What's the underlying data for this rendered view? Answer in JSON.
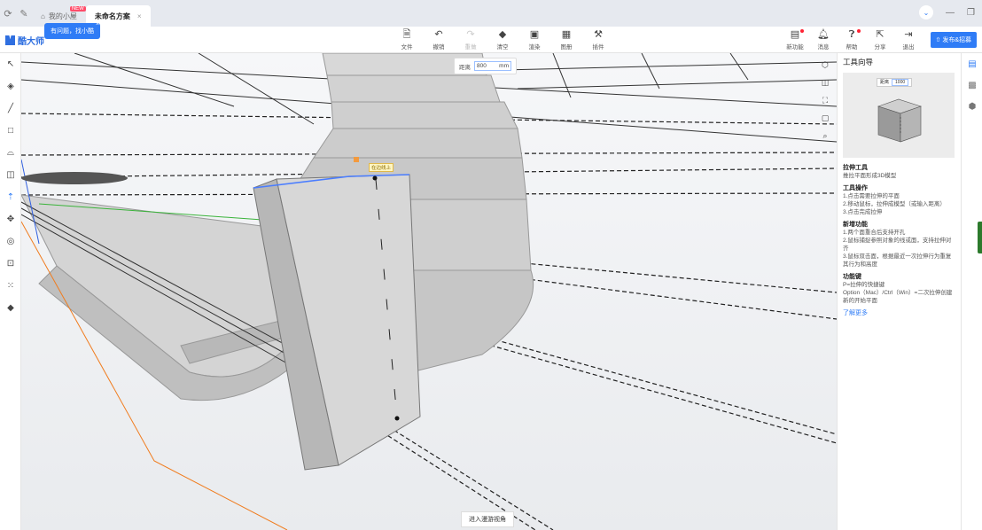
{
  "tabs": [
    {
      "label": "我的小屋",
      "badge": "NEW",
      "active": false
    },
    {
      "label": "未命名方案",
      "active": true
    }
  ],
  "tab_close": "×",
  "window_controls": {
    "min": "—",
    "max": "❐"
  },
  "logo_text": "酷大师",
  "tooltip": "有问题，找小酷",
  "tooltip_close": "×",
  "toolbar": {
    "file": "文件",
    "undo": "撤销",
    "redo": "重做",
    "clear": "清空",
    "render": "渲染",
    "drawing": "图册",
    "plugin": "插件"
  },
  "toolbar_right": {
    "new_feature": "新功能",
    "message": "消息",
    "help": "帮助",
    "share": "分享",
    "exit": "退出"
  },
  "publish_button": "发布&招募",
  "distance": {
    "label": "距离",
    "value": "800",
    "unit": "mm"
  },
  "snap_label": "在边线上",
  "enter_tour": "进入漫游视角",
  "right_panel": {
    "title": "工具向导",
    "preview_label": "距离",
    "preview_value": "1000",
    "tool_name": "拉伸工具",
    "tool_desc": "推拉平面形成3D模型",
    "ops_title": "工具操作",
    "ops": [
      "1.点击需要拉伸的平面",
      "2.移动鼠标，拉伸成模型（或输入距离）",
      "3.点击完成拉伸"
    ],
    "new_title": "新增功能",
    "new_items": [
      "1.两个面重合后支持开孔",
      "2.鼠标捕捉参照对象的线或面，支持拉伸对齐",
      "3.鼠标双击面，根据最近一次拉伸行为重复其行为和高度"
    ],
    "hotkey_title": "功能键",
    "hotkeys": [
      "P=拉伸的快捷键",
      "Option（Mac）/Ctrl（Win）=二次拉伸创建新的开始平面"
    ],
    "learn_more": "了解更多"
  },
  "colors": {
    "accent": "#2f7cf6",
    "viewport_bg": "#f1f2f4",
    "model_face": "#c9c9c9",
    "selected_edge": "#4a7dff"
  }
}
